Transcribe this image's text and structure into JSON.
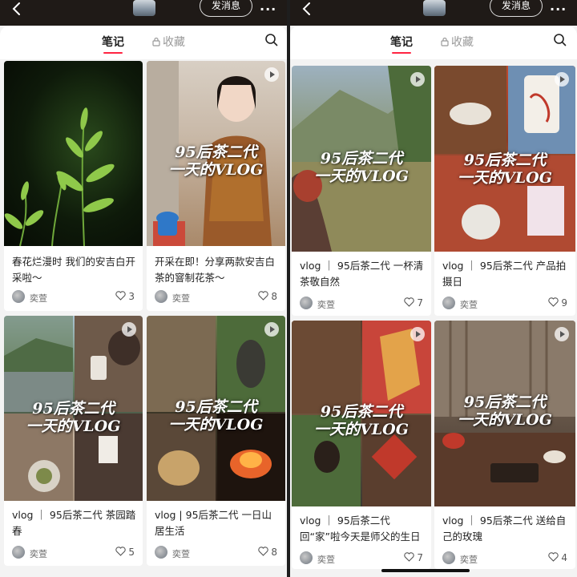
{
  "left": {
    "header": {
      "message_button": "发消息",
      "more": "···"
    },
    "tabs": {
      "notes": "笔记",
      "favorites": "收藏"
    },
    "cards": [
      {
        "title": "春花烂漫时 我们的安吉白开采啦～",
        "author": "奕萱",
        "likes": "3",
        "overlay": [
          "",
          ""
        ]
      },
      {
        "title": "开采在即！分享两款安吉白茶的窨制花茶～",
        "author": "奕萱",
        "likes": "8",
        "overlay": [
          "95后茶二代",
          "一天的VLOG"
        ]
      },
      {
        "title": "vlog ｜ 95后茶二代 茶园踏春",
        "author": "奕萱",
        "likes": "5",
        "overlay": [
          "95后茶二代",
          "一天的VLOG"
        ]
      },
      {
        "title": "vlog | 95后茶二代 一日山居生活",
        "author": "奕萱",
        "likes": "8",
        "overlay": [
          "95后茶二代",
          "一天的VLOG"
        ]
      }
    ]
  },
  "right": {
    "header": {
      "message_button": "发消息",
      "more": "···"
    },
    "tabs": {
      "notes": "笔记",
      "favorites": "收藏"
    },
    "cards": [
      {
        "title": "vlog ｜ 95后茶二代 一杯清茶敬自然",
        "author": "奕萱",
        "likes": "7",
        "overlay": [
          "95后茶二代",
          "一天的VLOG"
        ]
      },
      {
        "title": "vlog ｜ 95后茶二代 产品拍摄日",
        "author": "奕萱",
        "likes": "9",
        "overlay": [
          "95后茶二代",
          "一天的VLOG"
        ]
      },
      {
        "title": "vlog ｜ 95后茶二代 回“家”啦今天是师父的生日",
        "author": "奕萱",
        "likes": "7",
        "overlay": [
          "95后茶二代",
          "一天的VLOG"
        ]
      },
      {
        "title": "vlog ｜ 95后茶二代 送给自己的玫瑰",
        "author": "奕萱",
        "likes": "4",
        "overlay": [
          "95后茶二代",
          "一天的VLOG"
        ]
      }
    ]
  },
  "icons": [
    "back-icon",
    "more-icon",
    "lock-icon",
    "search-icon",
    "play-icon",
    "heart-icon"
  ],
  "colors": {
    "accent": "#ff2442",
    "topbar": "#1f1a17",
    "background": "#f3f3f3",
    "card": "#ffffff"
  }
}
